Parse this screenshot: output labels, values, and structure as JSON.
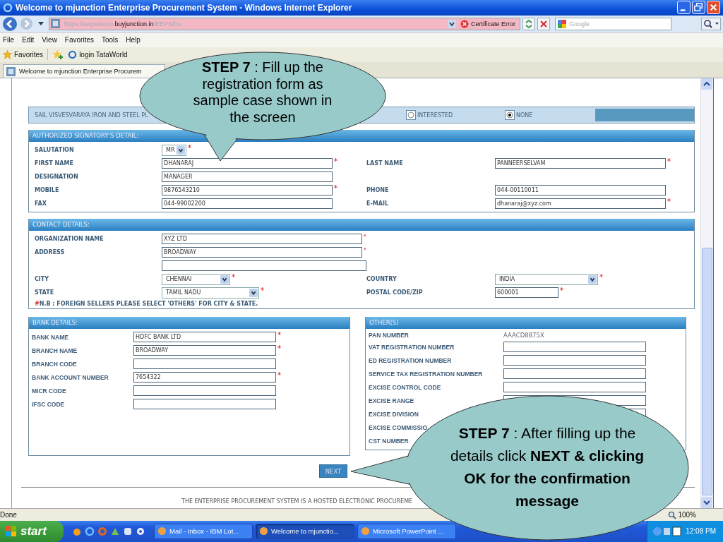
{
  "window": {
    "title": "Welcome to mjunction Enterprise Procurement System - Windows Internet Explorer"
  },
  "address_bar": {
    "url": "https://eepsdemo.**buyjunction.in**/EEPS/bu",
    "certificate_error": "Certificate Error",
    "search_placeholder": "Google"
  },
  "menu": [
    "File",
    "Edit",
    "View",
    "Favorites",
    "Tools",
    "Help"
  ],
  "favorites_bar": {
    "label": "Favorites",
    "links": [
      "login TataWorld"
    ]
  },
  "tab": {
    "title": "Welcome to mjunction Enterprise Procurem"
  },
  "interest": {
    "company": "SAIL VISVESVARAYA IRON AND STEEL PL",
    "options": [
      {
        "label": "INTERESTED",
        "selected": false
      },
      {
        "label": "NONE",
        "selected": true
      }
    ]
  },
  "sections": [
    {
      "title": "AUTHORIZED SIGNATORY'S DETAIL:",
      "rows": [
        {
          "fields": [
            {
              "label": "SALUTATION",
              "kind": "small-select",
              "value": "MR",
              "required": true
            }
          ]
        },
        {
          "fields": [
            {
              "label": "FIRST NAME",
              "kind": "text",
              "value": "DHANARAJ",
              "required": true
            },
            {
              "label": "LAST NAME",
              "kind": "text",
              "value": "PANNEERSELVAM",
              "required": true
            }
          ]
        },
        {
          "fields": [
            {
              "label": "DESIGNATION",
              "kind": "text",
              "value": "MANAGER",
              "required": false
            }
          ]
        },
        {
          "fields": [
            {
              "label": "MOBILE",
              "kind": "text",
              "value": "9876543210",
              "required": true
            },
            {
              "label": "PHONE",
              "kind": "text",
              "value": "044-00110011",
              "required": false
            }
          ]
        },
        {
          "fields": [
            {
              "label": "FAX",
              "kind": "text",
              "value": "044-99002200",
              "required": false
            },
            {
              "label": "E-MAIL",
              "kind": "text",
              "value": "dhanaraj@xyz.com",
              "required": true
            }
          ]
        }
      ]
    },
    {
      "title": "CONTACT DETAILS:",
      "rows": [
        {
          "fields": [
            {
              "label": "ORGANIZATION NAME",
              "kind": "long-text",
              "value": "XYZ LTD",
              "required": true
            }
          ]
        },
        {
          "fields": [
            {
              "label": "ADDRESS",
              "kind": "long-text",
              "value": "BROADWAY",
              "required": true
            }
          ]
        },
        {
          "fields": [
            {
              "kind": "medium-text",
              "required": false
            }
          ]
        },
        {
          "fields": [
            {
              "label": "CITY",
              "kind": "select",
              "value": "CHENNAI",
              "required": true
            },
            {
              "label": "COUNTRY",
              "kind": "long-select",
              "value": "INDIA",
              "required": true
            }
          ]
        },
        {
          "fields": [
            {
              "label": "STATE",
              "kind": "medium-select",
              "value": "TAMIL NADU",
              "required": true
            },
            {
              "label": "POSTAL CODE/ZIP",
              "kind": "short-text",
              "value": "600001",
              "required": true
            }
          ]
        }
      ],
      "note": {
        "mark": "#",
        "text": "N.B : FOREIGN SELLERS PLEASE SELECT 'OTHERS' FOR CITY & STATE."
      }
    }
  ],
  "bank": {
    "title": "BANK DETAILS:",
    "fields": [
      {
        "label": "BANK NAME",
        "kind": "text",
        "value": "HDFC BANK LTD",
        "required": true
      },
      {
        "label": "BRANCH NAME",
        "kind": "text",
        "value": "BROADWAY",
        "required": true
      },
      {
        "label": "BRANCH CODE",
        "kind": "text",
        "required": false
      },
      {
        "label": "BANK ACCOUNT NUMBER",
        "kind": "text",
        "value": "7654322",
        "required": true
      },
      {
        "label": "MICR CODE",
        "kind": "text",
        "required": false
      },
      {
        "label": "IFSC CODE",
        "kind": "text",
        "required": false
      }
    ]
  },
  "others": {
    "title": "OTHER(S)",
    "fields": [
      {
        "label": "PAN NUMBER",
        "kind": "static",
        "value": "AAACD8875X",
        "required": false
      },
      {
        "label": "VAT REGISTRATION NUMBER",
        "kind": "text",
        "required": false
      },
      {
        "label": "ED REGISTRATION NUMBER",
        "kind": "text",
        "required": false
      },
      {
        "label": "SERVICE TAX REGISTRATION NUMBER",
        "kind": "text",
        "required": false
      },
      {
        "label": "EXCISE CONTROL CODE",
        "kind": "text",
        "required": false
      },
      {
        "label": "EXCISE RANGE",
        "kind": "text",
        "required": false
      },
      {
        "label": "EXCISE DIVISION",
        "kind": "text",
        "required": false
      },
      {
        "label": "EXCISE COMMISSIO",
        "kind": "none",
        "required": false
      },
      {
        "label": "CST NUMBER",
        "kind": "none",
        "required": false
      }
    ]
  },
  "next_button": "NEXT",
  "footer": "THE ENTERPRISE PROCUREMENT SYSTEM IS A HOSTED ELECTRONIC PROCUREME",
  "status_bar": {
    "status": "Done",
    "zoom": "100%"
  },
  "taskbar": {
    "start": "start",
    "tasks": [
      {
        "label": "Mail - Inbox - IBM Lot...",
        "selected": false
      },
      {
        "label": "Welcome to mjunctio...",
        "selected": true
      },
      {
        "label": "Microsoft PowerPoint ...",
        "selected": false
      }
    ],
    "time": "12:08 PM"
  },
  "callouts": [
    {
      "text": "**STEP 7** : Fill up the registration form as sample case shown in the screen"
    },
    {
      "text": "**STEP 7** : After filling up the details click **NEXT & clicking OK for the confirmation message**"
    }
  ]
}
